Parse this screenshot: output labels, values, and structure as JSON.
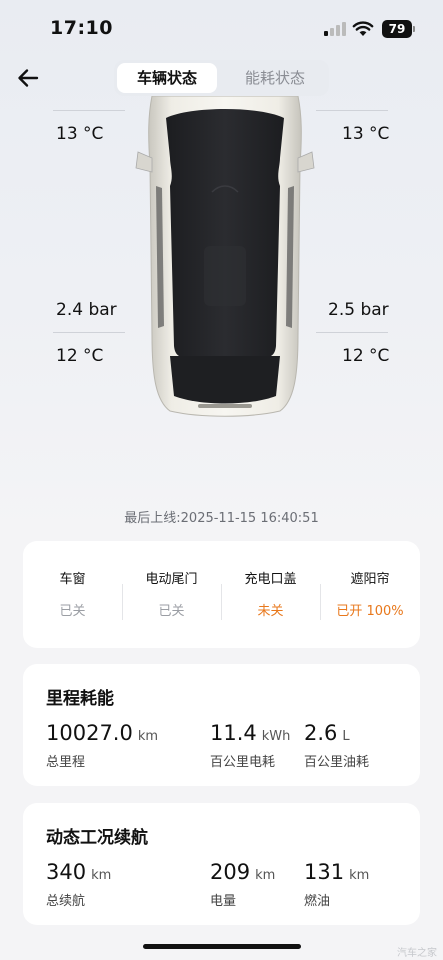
{
  "status_bar": {
    "time": "17:10",
    "battery": "79"
  },
  "tabs": {
    "active": "车辆状态",
    "inactive": "能耗状态"
  },
  "tires": {
    "front_left_temp": "13 °C",
    "front_right_temp": "13 °C",
    "rear_left_pressure": "2.4 bar",
    "rear_right_pressure": "2.5 bar",
    "rear_left_temp": "12 °C",
    "rear_right_temp": "12 °C"
  },
  "last_online": "最后上线:2025-11-15 16:40:51",
  "vehicle_status": [
    {
      "label": "车窗",
      "value": "已关",
      "state": "normal"
    },
    {
      "label": "电动尾门",
      "value": "已关",
      "state": "normal"
    },
    {
      "label": "充电口盖",
      "value": "未关",
      "state": "warn"
    },
    {
      "label": "遮阳帘",
      "value": "已开 100%",
      "state": "warn"
    }
  ],
  "mileage": {
    "title": "里程耗能",
    "total": {
      "value": "10027.0",
      "unit": "km",
      "label": "总里程"
    },
    "power": {
      "value": "11.4",
      "unit": "kWh",
      "label": "百公里电耗"
    },
    "fuel": {
      "value": "2.6",
      "unit": "L",
      "label": "百公里油耗"
    }
  },
  "range": {
    "title": "动态工况续航",
    "total": {
      "value": "340",
      "unit": "km",
      "label": "总续航"
    },
    "electric": {
      "value": "209",
      "unit": "km",
      "label": "电量"
    },
    "fuel": {
      "value": "131",
      "unit": "km",
      "label": "燃油"
    }
  },
  "watermark": "汽车之家",
  "colors": {
    "warn": "#e8781c",
    "muted": "#9b9ea4"
  }
}
